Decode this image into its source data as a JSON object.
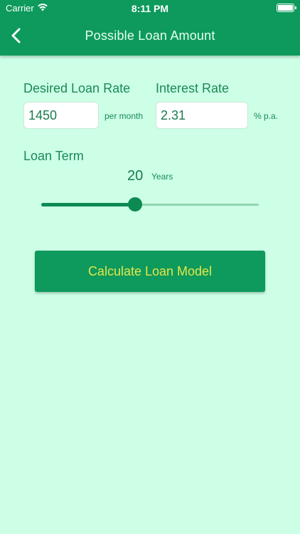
{
  "status_bar": {
    "carrier": "Carrier",
    "time": "8:11 PM",
    "icons": [
      "wifi-icon",
      "battery-icon"
    ]
  },
  "nav": {
    "back_icon": "chevron-left-icon",
    "title": "Possible Loan Amount"
  },
  "form": {
    "desired_rate_label": "Desired Loan Rate",
    "desired_rate_value": "1450",
    "desired_rate_unit": "per month",
    "interest_label": "Interest Rate",
    "interest_value": "2.31",
    "interest_unit": "% p.a.",
    "term_label": "Loan Term",
    "term_value": "20",
    "term_unit": "Years",
    "term_slider_fraction": 0.43
  },
  "actions": {
    "calculate_label": "Calculate Loan Model"
  },
  "colors": {
    "background": "#ccffe6",
    "primary": "#0d9a5c",
    "text": "#1a8a55",
    "button_text": "#e6e64a"
  }
}
